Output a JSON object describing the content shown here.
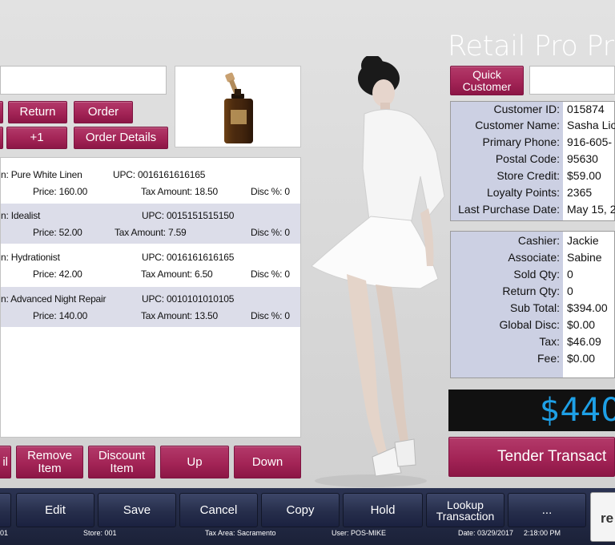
{
  "app": {
    "title": "Retail Pro Pri"
  },
  "actions": {
    "return": "Return",
    "order": "Order",
    "plus_one": "+1",
    "order_details": "Order Details"
  },
  "items": [
    {
      "name": "n: Pure White Linen",
      "upc": "UPC: 0016161616165",
      "price": "Price: 160.00",
      "tax": "Tax Amount: 18.50",
      "disc": "Disc %: 0"
    },
    {
      "name": "n: Idealist",
      "upc": "UPC: 0015151515150",
      "price": "Price: 52.00",
      "tax": "Tax Amount: 7.59",
      "disc": "Disc %: 0"
    },
    {
      "name": "n: Hydrationist",
      "upc": "UPC: 0016161616165",
      "price": "Price: 42.00",
      "tax": "Tax Amount: 6.50",
      "disc": "Disc %: 0"
    },
    {
      "name": "n: Advanced Night Repair",
      "upc": "UPC: 0010101010105",
      "price": "Price: 140.00",
      "tax": "Tax Amount: 13.50",
      "disc": "Disc %: 0"
    }
  ],
  "item_buttons": {
    "partial": "il",
    "remove": "Remove Item",
    "discount": "Discount Item",
    "up": "Up",
    "down": "Down"
  },
  "customer": {
    "quick_customer": "Quick Customer",
    "fields": [
      {
        "label": "Customer ID:",
        "value": "015874"
      },
      {
        "label": "Customer Name:",
        "value": "Sasha Lio"
      },
      {
        "label": "Primary Phone:",
        "value": "916-605-"
      },
      {
        "label": "Postal Code:",
        "value": "95630"
      },
      {
        "label": "Store Credit:",
        "value": "$59.00"
      },
      {
        "label": "Loyalty Points:",
        "value": "2365"
      },
      {
        "label": "Last Purchase Date:",
        "value": "May 15, 2"
      }
    ]
  },
  "transaction": {
    "fields": [
      {
        "label": "Cashier:",
        "value": "Jackie"
      },
      {
        "label": "Associate:",
        "value": "Sabine"
      },
      {
        "label": "Sold Qty:",
        "value": "0"
      },
      {
        "label": "Return Qty:",
        "value": "0"
      },
      {
        "label": "Sub Total:",
        "value": "$394.00"
      },
      {
        "label": "Global Disc:",
        "value": "$0.00"
      },
      {
        "label": "Tax:",
        "value": "$46.09"
      },
      {
        "label": "Fee:",
        "value": "$0.00"
      }
    ],
    "total": "$440",
    "tender": "Tender Transact"
  },
  "toolbar": {
    "edit": "Edit",
    "save": "Save",
    "cancel": "Cancel",
    "copy": "Copy",
    "hold": "Hold",
    "lookup": "Lookup Transaction",
    "more": "...",
    "logo": "re"
  },
  "status": {
    "left": "01",
    "store": "Store: 001",
    "tax_area": "Tax Area: Sacramento",
    "user": "User: POS-MIKE",
    "date": "Date: 03/29/2017",
    "time": "2:18:00 PM"
  },
  "colors": {
    "accent": "#a32456",
    "panel_label": "#ccd0e3",
    "row_alt": "#dcdde9",
    "total_text": "#1ea0e6",
    "toolbar": "#262e4b"
  }
}
